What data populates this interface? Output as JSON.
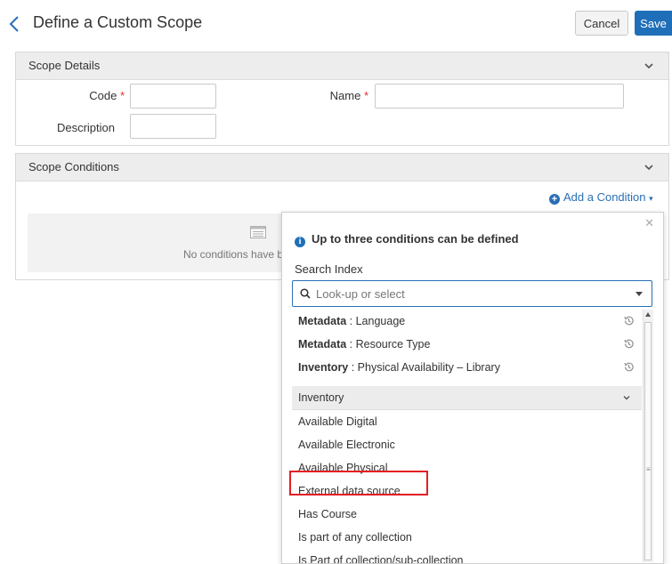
{
  "header": {
    "title": "Define a Custom Scope",
    "cancel_label": "Cancel",
    "save_label": "Save"
  },
  "scope_details": {
    "title": "Scope Details",
    "code_label": "Code",
    "name_label": "Name",
    "description_label": "Description",
    "required_mark": "*",
    "code_value": "",
    "name_value": "",
    "description_value": ""
  },
  "scope_conditions": {
    "title": "Scope Conditions",
    "add_condition_label": "Add a Condition",
    "empty_text": "No conditions have b"
  },
  "condition_popover": {
    "info_text": "Up to three conditions can be defined",
    "search_index_label": "Search Index",
    "search_placeholder": "Look-up or select",
    "recent": [
      {
        "category": "Metadata",
        "field": " : Language"
      },
      {
        "category": "Metadata",
        "field": " : Resource Type"
      },
      {
        "category": "Inventory",
        "field": " : Physical Availability – Library"
      }
    ],
    "group_label": "Inventory",
    "options": [
      "Available Digital",
      "Available Electronic",
      "Available Physical",
      "External data source",
      "Has Course",
      "Is part of any collection",
      "Is Part of collection/sub-collection"
    ],
    "highlighted_option": "External data source"
  },
  "colors": {
    "primary": "#1f6fb8",
    "link": "#2a6fb5",
    "required": "#e03030",
    "highlight": "#e31e24"
  }
}
